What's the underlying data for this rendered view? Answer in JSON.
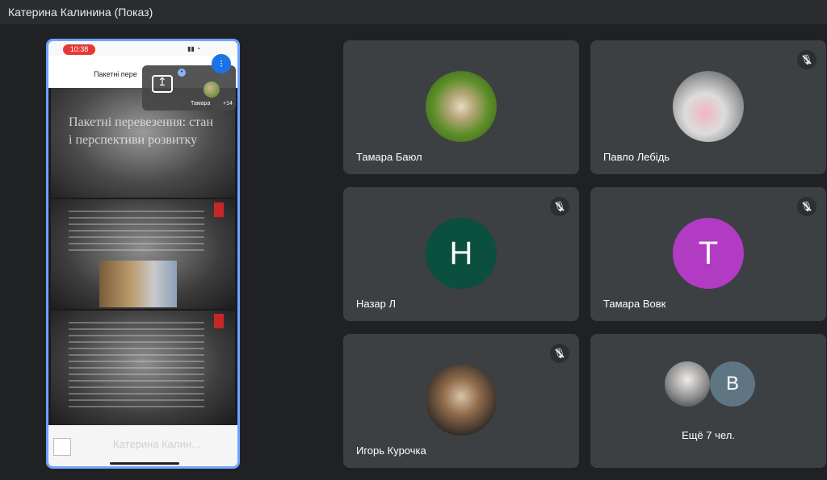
{
  "window": {
    "title": "Катерина Калинина (Показ)"
  },
  "presentation": {
    "status_time": "10:38",
    "doc_title": "Пакетні пере",
    "pip": {
      "name": "Тамара",
      "count": "+14"
    },
    "slide_title": "Пакетні перевезення: стан і перспективи розвитку",
    "presenter_name": "Катерина Калин..."
  },
  "participants": [
    {
      "name": "Тамара Баюл",
      "avatar_type": "image",
      "muted": false
    },
    {
      "name": "Павло Лебідь",
      "avatar_type": "image",
      "muted": true
    },
    {
      "name": "Назар Л",
      "avatar_letter": "Н",
      "avatar_color": "#0b4f3e",
      "muted": true
    },
    {
      "name": "Тамара Вовк",
      "avatar_letter": "T",
      "avatar_color": "#b23bc4",
      "muted": true
    },
    {
      "name": "Игорь Курочка",
      "avatar_type": "image",
      "muted": true
    }
  ],
  "more": {
    "letter": "B",
    "text": "Ещё 7 чел."
  },
  "icons": {
    "mute": "mic-off-icon",
    "present": "present-screen-icon",
    "audio": "audio-level-icon"
  }
}
